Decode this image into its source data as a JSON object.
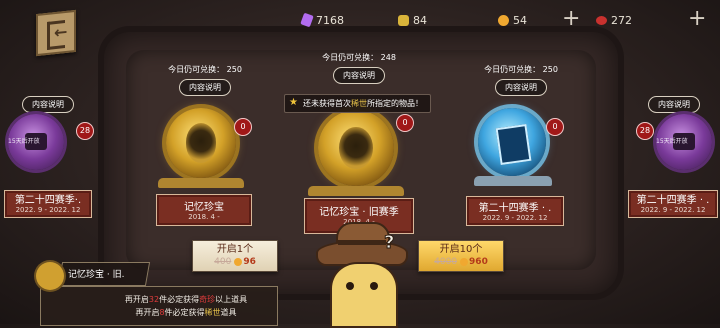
{
  "currencies": [
    {
      "icon": "purple-gem-icon",
      "value": "7168"
    },
    {
      "icon": "puzzle-piece-icon",
      "value": "84"
    },
    {
      "icon": "gold-coin-icon",
      "value": "54"
    },
    {
      "icon": "red-gem-icon",
      "value": "272"
    }
  ],
  "plus_label": "+",
  "cards": {
    "left_edge": {
      "info": "内容说明",
      "badge": "28",
      "lock": "15天后开放",
      "title": "第二十四赛季·.",
      "date": "2022. 9 - 2022. 12"
    },
    "left": {
      "quota": "今日仍可兑换： 250",
      "info": "内容说明",
      "badge": "0",
      "title": "记忆珍宝",
      "date": "2018. 4 -"
    },
    "center": {
      "quota": "今日仍可兑换： 248",
      "info": "内容说明",
      "badge": "0",
      "title": "记忆珍宝 · 旧赛季",
      "date": "2018. 4 -"
    },
    "right": {
      "quota": "今日仍可兑换： 250",
      "info": "内容说明",
      "badge": "0",
      "title": "第二十四赛季 · .",
      "date": "2022. 9 - 2022. 12"
    },
    "right_edge": {
      "info": "内容说明",
      "badge": "28",
      "lock": "15天后开放",
      "title": "第二十四赛季 · .",
      "date": "2022. 9 - 2022. 12"
    }
  },
  "tooltip": {
    "pre": "还未获得首次",
    "hl": "稀世",
    "post": "所指定的物品！"
  },
  "buttons": {
    "open1": {
      "label": "开启1个",
      "old_price": "400",
      "new_price": "96"
    },
    "open10": {
      "label": "开启10个",
      "old_price": "4000",
      "new_price": "960"
    }
  },
  "bottom_panel": {
    "label": "记忆珍宝 · 旧.",
    "line1_pre": "再开启",
    "line1_count": "32",
    "line1_mid": "件必定获得",
    "line1_hl": "奇珍",
    "line1_post": "以上道具",
    "line2_pre": "再开启",
    "line2_count": "8",
    "line2_mid": "件必定获得",
    "line2_hl": "稀世",
    "line2_post": "道具"
  },
  "mascot_mark": "?",
  "back_arrow": "←",
  "star_glyph": "★"
}
